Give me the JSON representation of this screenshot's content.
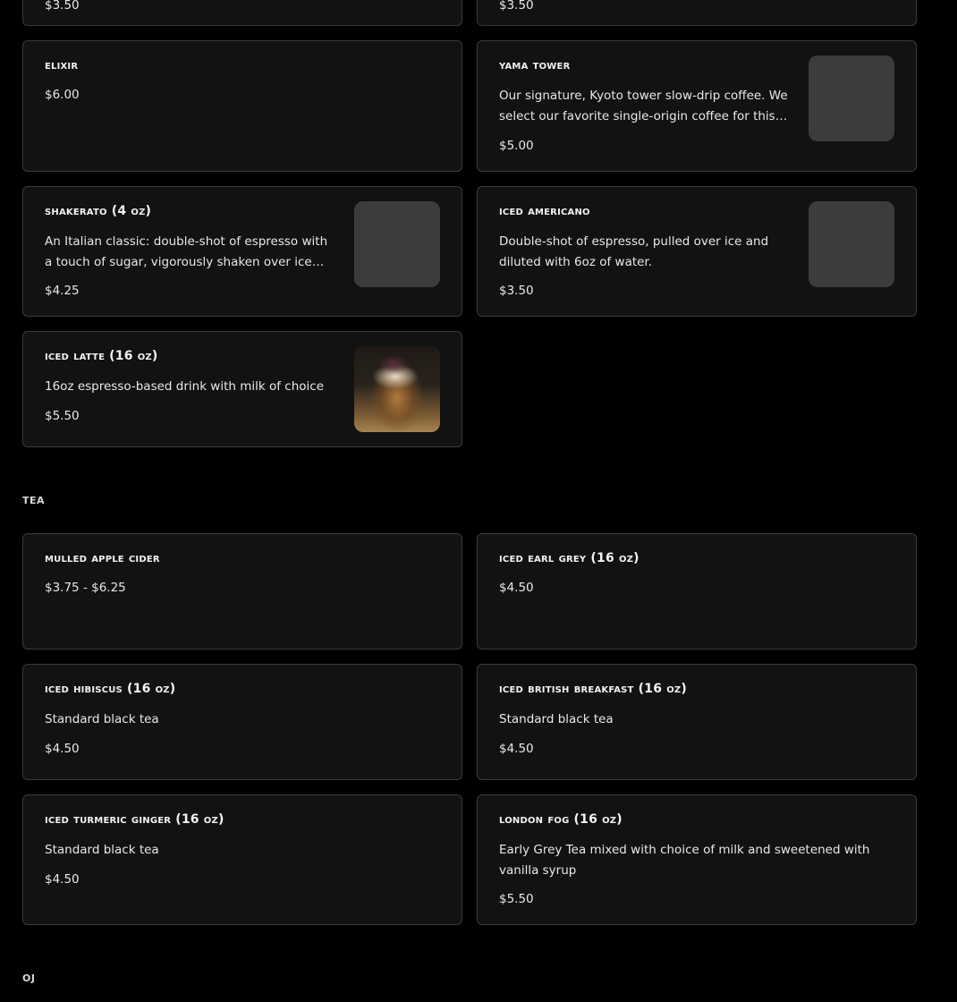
{
  "coffee": {
    "top_left_price": "$3.50",
    "top_right_price": "$3.50",
    "items": [
      {
        "name": "Elixir",
        "desc": "",
        "price": "$6.00"
      },
      {
        "name": "Yama Tower",
        "desc": "Our signature, Kyoto tower slow-drip coffee. We select our favorite single-origin coffee for this an…",
        "price": "$5.00"
      },
      {
        "name": "Shakerato (4 oz)",
        "desc": "An Italian classic: double-shot of espresso with a touch of sugar, vigorously shaken over ice for a…",
        "price": "$4.25"
      },
      {
        "name": "Iced Americano",
        "desc": "Double-shot of espresso, pulled over ice and diluted with 6oz of water.",
        "price": "$3.50"
      },
      {
        "name": "Iced Latte (16 oz)",
        "desc": "16oz espresso-based drink with milk of choice",
        "price": "$5.50"
      }
    ]
  },
  "tea": {
    "title": "Tea",
    "items": [
      {
        "name": "Mulled Apple Cider",
        "desc": "",
        "price": "$3.75 - $6.25"
      },
      {
        "name": "Iced Earl Grey (16 oz)",
        "desc": "",
        "price": "$4.50"
      },
      {
        "name": "Iced Hibiscus (16 oz)",
        "desc": "Standard black tea",
        "price": "$4.50"
      },
      {
        "name": "Iced British Breakfast (16 oz)",
        "desc": "Standard black tea",
        "price": "$4.50"
      },
      {
        "name": "Iced Turmeric Ginger (16 oz)",
        "desc": "Standard black tea",
        "price": "$4.50"
      },
      {
        "name": "London Fog (16 oz)",
        "desc": "Early Grey Tea mixed with choice of milk and sweetened with vanilla syrup",
        "price": "$5.50"
      }
    ]
  },
  "oj": {
    "title": "OJ"
  }
}
